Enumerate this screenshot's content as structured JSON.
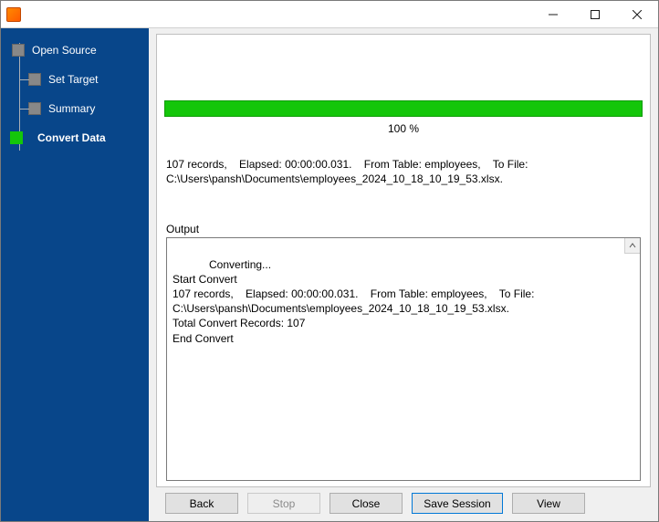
{
  "window": {
    "title": ""
  },
  "sidebar": {
    "steps": [
      {
        "label": "Open Source"
      },
      {
        "label": "Set Target"
      },
      {
        "label": "Summary"
      },
      {
        "label": "Convert Data"
      }
    ]
  },
  "progress": {
    "percent_label": "100 %",
    "summary_line": "107 records,    Elapsed: 00:00:00.031.    From Table: employees,    To File: C:\\Users\\pansh\\Documents\\employees_2024_10_18_10_19_53.xlsx."
  },
  "output": {
    "label": "Output",
    "lines": "Converting...\nStart Convert\n107 records,    Elapsed: 00:00:00.031.    From Table: employees,    To File: C:\\Users\\pansh\\Documents\\employees_2024_10_18_10_19_53.xlsx.\nTotal Convert Records: 107\nEnd Convert"
  },
  "buttons": {
    "back": "Back",
    "stop": "Stop",
    "close": "Close",
    "save_session": "Save Session",
    "view": "View"
  }
}
